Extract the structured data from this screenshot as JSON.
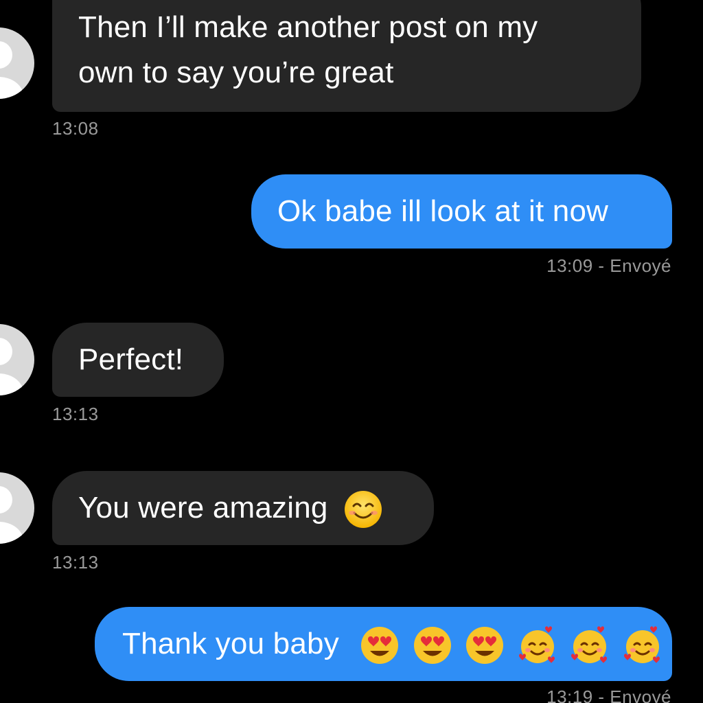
{
  "messages": [
    {
      "id": "m1",
      "direction": "incoming",
      "line_top": "…",
      "line1": "Then I’ll make another post on my",
      "line2": "own to say you’re great",
      "time": "13:08"
    },
    {
      "id": "m2",
      "direction": "outgoing",
      "text": "Ok babe ill look at it now",
      "status": "13:09 - Envoyé"
    },
    {
      "id": "m3",
      "direction": "incoming",
      "text": "Perfect!",
      "time": "13:13"
    },
    {
      "id": "m4",
      "direction": "incoming",
      "text": "You were amazing",
      "emojis": [
        "smiling-face-icon"
      ],
      "time": "13:13"
    },
    {
      "id": "m5",
      "direction": "outgoing",
      "text": "Thank you baby",
      "emojis": [
        "heart-eyes-icon",
        "heart-eyes-icon",
        "heart-eyes-icon",
        "smiling-hearts-icon",
        "smiling-hearts-icon",
        "smiling-hearts-icon"
      ],
      "status": "13:19 - Envoyé"
    }
  ],
  "colors": {
    "background": "#000000",
    "incoming_bubble": "#262626",
    "outgoing_bubble": "#2f8ef6",
    "timestamp": "#9a9a9a",
    "avatar": "#d9d9d9"
  }
}
